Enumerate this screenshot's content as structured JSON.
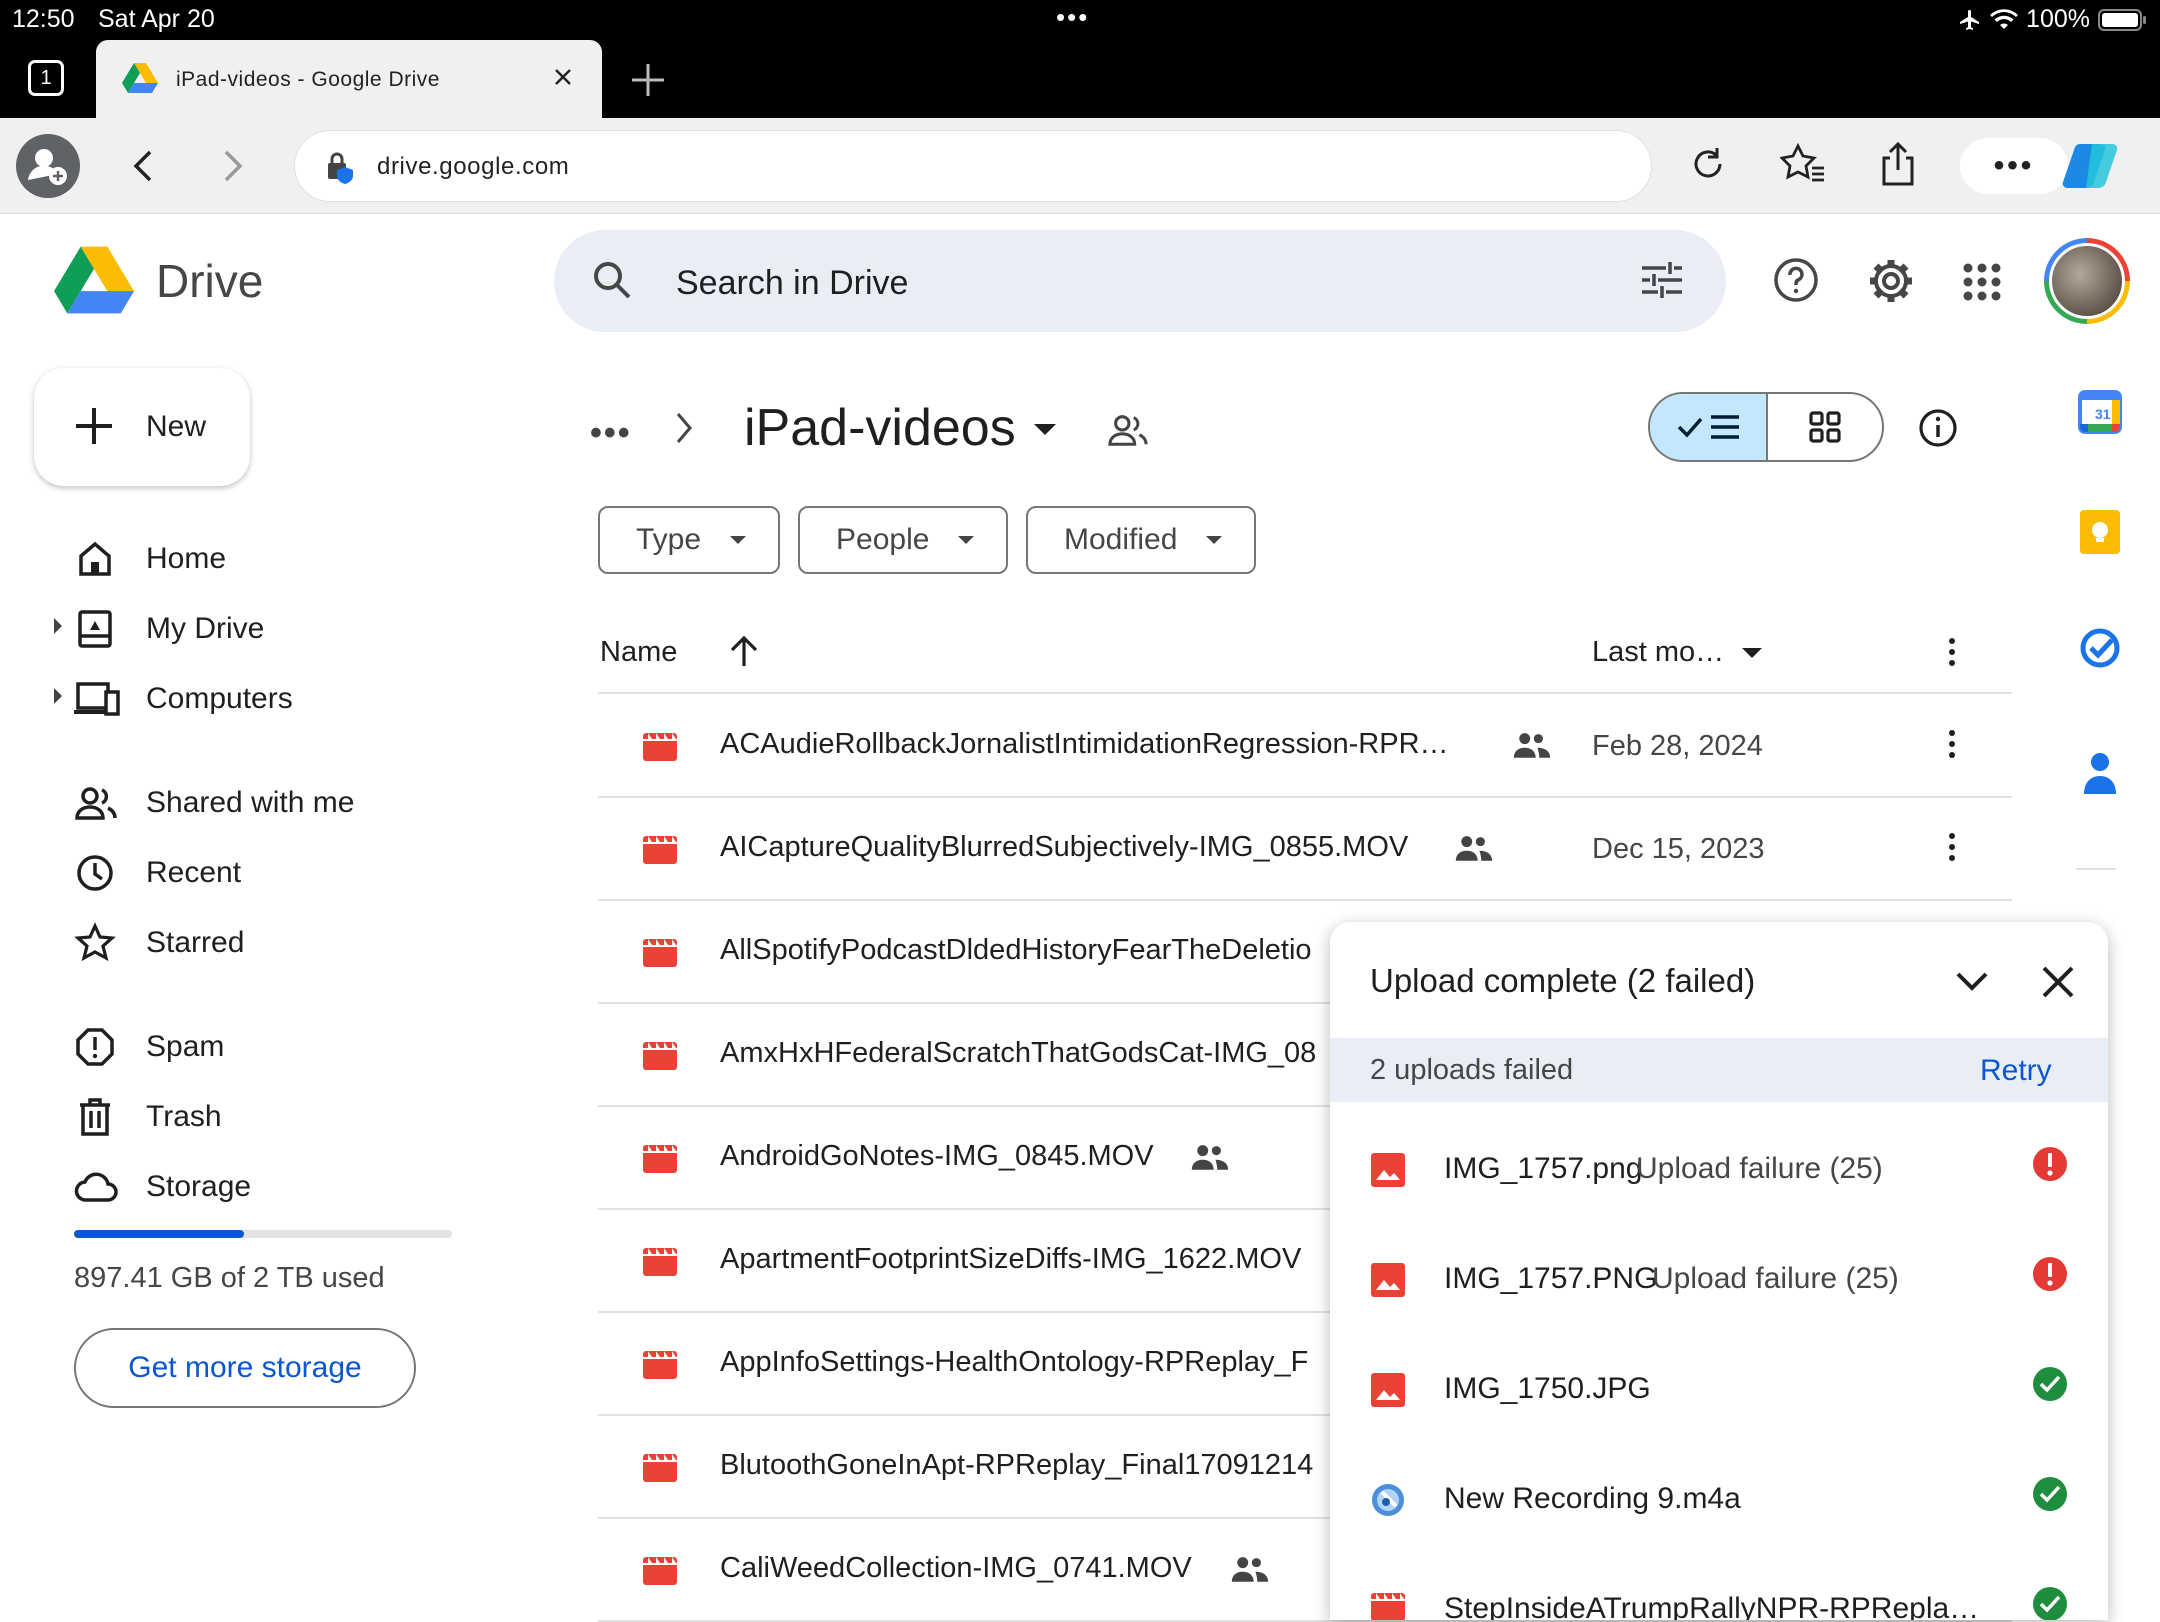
{
  "status_bar": {
    "time": "12:50",
    "date": "Sat Apr 20",
    "dots": "•••",
    "battery": "100%"
  },
  "browser": {
    "tab_count": "1",
    "tab_title": "iPad-videos - Google Drive",
    "url": "drive.google.com"
  },
  "drive": {
    "logo_text": "Drive",
    "search_placeholder": "Search in Drive"
  },
  "sidebar": {
    "new_label": "New",
    "items": [
      {
        "label": "Home",
        "icon": "home-icon"
      },
      {
        "label": "My Drive",
        "icon": "my-drive-icon"
      },
      {
        "label": "Computers",
        "icon": "computers-icon"
      },
      {
        "label": "Shared with me",
        "icon": "shared-icon"
      },
      {
        "label": "Recent",
        "icon": "clock-icon"
      },
      {
        "label": "Starred",
        "icon": "star-icon"
      },
      {
        "label": "Spam",
        "icon": "spam-icon"
      },
      {
        "label": "Trash",
        "icon": "trash-icon"
      },
      {
        "label": "Storage",
        "icon": "cloud-icon"
      }
    ],
    "storage_used_fraction": 0.45,
    "storage_text": "897.41 GB of 2 TB used",
    "get_more_label": "Get more storage"
  },
  "main": {
    "breadcrumb_more": "•••",
    "folder_name": "iPad-videos",
    "filters": [
      "Type",
      "People",
      "Modified"
    ],
    "col_name": "Name",
    "col_modified": "Last mo…",
    "files": [
      {
        "name": "ACAudieRollbackJornalistIntimidationRegression-RPR…",
        "shared": true,
        "date": "Feb 28, 2024"
      },
      {
        "name": "AICaptureQualityBlurredSubjectively-IMG_0855.MOV",
        "shared": true,
        "date": "Dec 15, 2023"
      },
      {
        "name": "AllSpotifyPodcastDldedHistoryFearTheDeletio",
        "shared": false,
        "date": ""
      },
      {
        "name": "AmxHxHFederalScratchThatGodsCat-IMG_08",
        "shared": false,
        "date": ""
      },
      {
        "name": "AndroidGoNotes-IMG_0845.MOV",
        "shared": true,
        "date": ""
      },
      {
        "name": "ApartmentFootprintSizeDiffs-IMG_1622.MOV",
        "shared": false,
        "date": ""
      },
      {
        "name": "AppInfoSettings-HealthOntology-RPReplay_F",
        "shared": false,
        "date": ""
      },
      {
        "name": "BlutoothGoneInApt-RPReplay_Final17091214",
        "shared": false,
        "date": ""
      },
      {
        "name": "CaliWeedCollection-IMG_0741.MOV",
        "shared": true,
        "date": ""
      }
    ]
  },
  "upload": {
    "title": "Upload complete (2 failed)",
    "failed_text": "2 uploads failed",
    "retry_label": "Retry",
    "items": [
      {
        "name": "IMG_1757.png",
        "status": "Upload failure (25)",
        "state": "error",
        "type": "image"
      },
      {
        "name": "IMG_1757.PNG",
        "status": "Upload failure (25)",
        "state": "error",
        "type": "image"
      },
      {
        "name": "IMG_1750.JPG",
        "status": "",
        "state": "success",
        "type": "image"
      },
      {
        "name": "New Recording 9.m4a",
        "status": "",
        "state": "success",
        "type": "audio"
      },
      {
        "name": "StepInsideATrumpRallyNPR-RPRepla…",
        "status": "",
        "state": "success",
        "type": "video"
      }
    ]
  },
  "colors": {
    "accent": "#0b57d0",
    "selected_toggle": "#c2e7ff",
    "error": "#e53935",
    "success": "#1e8e3e",
    "file_red": "#ea4335"
  }
}
